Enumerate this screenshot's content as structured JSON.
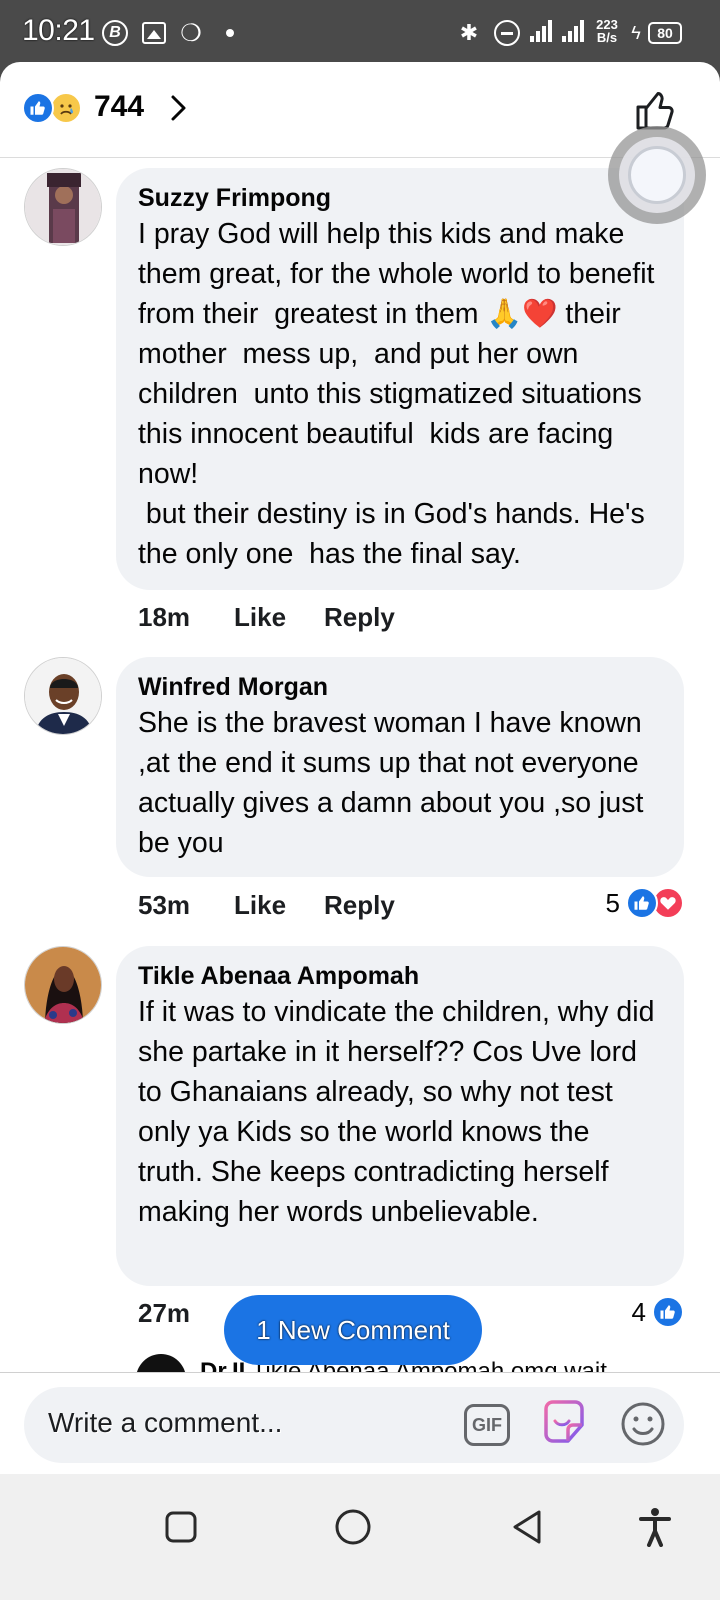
{
  "status_bar": {
    "time": "10:21",
    "speed_top": "223",
    "speed_bottom": "B/s",
    "battery": "80"
  },
  "header": {
    "reaction_count": "744"
  },
  "comments": [
    {
      "name": "Suzzy Frimpong",
      "text": "I pray God will help this kids and make them great, for the whole world to benefit from their  greatest in them 🙏❤️ their mother  mess up,  and put her own children  unto this stigmatized situations this innocent beautiful  kids are facing  now!\n but their destiny is in God's hands. He's  the only one  has the final say.",
      "time": "18m",
      "like": "Like",
      "reply": "Reply"
    },
    {
      "name": "Winfred Morgan",
      "text": "She is the bravest woman I have known ,at the end it sums up that not everyone actually gives a damn about you ,so just be you",
      "time": "53m",
      "like": "Like",
      "reply": "Reply",
      "reaction_count": "5"
    },
    {
      "name": "Tikle Abenaa Ampomah",
      "text": "If it was to vindicate the children, why did she partake in it herself?? Cos Uve lord to Ghanaians already, so why not test only ya Kids so the world knows the truth. She keeps contradicting herself making her words unbelievable.",
      "time": "27m",
      "reaction_count": "4"
    }
  ],
  "new_comment_pill": "1 New Comment",
  "peek": {
    "name": "Dr.II",
    "text": "Tikle Abenaa Ampomah omg wait"
  },
  "composer": {
    "placeholder": "Write a comment...",
    "gif_label": "GIF"
  },
  "colors": {
    "facebook_blue": "#1b74e4",
    "bubble": "#f0f2f5",
    "heart": "#f33e58"
  }
}
